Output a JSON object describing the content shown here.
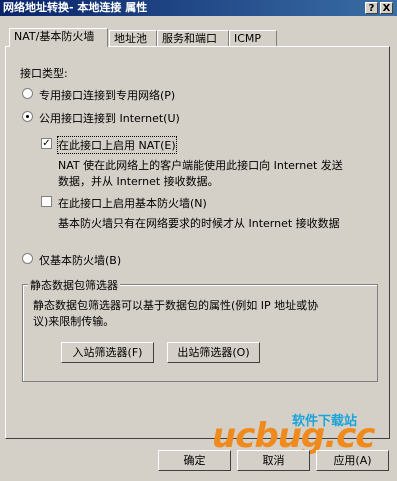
{
  "window": {
    "title": "网络地址转换- 本地连接 属性",
    "help_btn": "?",
    "close_btn": "X"
  },
  "tabs": [
    {
      "label": "NAT/基本防火墙"
    },
    {
      "label": "地址池"
    },
    {
      "label": "服务和端口"
    },
    {
      "label": "ICMP"
    }
  ],
  "interface_type": {
    "heading": "接口类型:",
    "private_option": "专用接口连接到专用网络(P)",
    "public_option": "公用接口连接到 Internet(U)",
    "enable_nat_label": "在此接口上启用 NAT(E)",
    "nat_desc_line1": "NAT 使在此网络上的客户端能使用此接口向 Internet 发送",
    "nat_desc_line2": "数据，并从 Internet 接收数据。",
    "enable_fw_label": "在此接口上启用基本防火墙(N)",
    "fw_desc": "基本防火墙只有在网络要求的时候才从 Internet 接收数据",
    "fw_only_option": "仅基本防火墙(B)",
    "selected": "public",
    "nat_checked": true,
    "fw_checked": false
  },
  "packet_filter": {
    "legend": "静态数据包筛选器",
    "desc_line1": "静态数据包筛选器可以基于数据包的属性(例如 IP 地址或协",
    "desc_line2": "议)来限制传输。",
    "inbound_btn": "入站筛选器(F)",
    "outbound_btn": "出站筛选器(O)"
  },
  "footer": {
    "ok": "确定",
    "cancel": "取消",
    "apply": "应用(A)"
  },
  "watermark": {
    "site": "软件下载站",
    "brand": "ucbug.cc"
  }
}
